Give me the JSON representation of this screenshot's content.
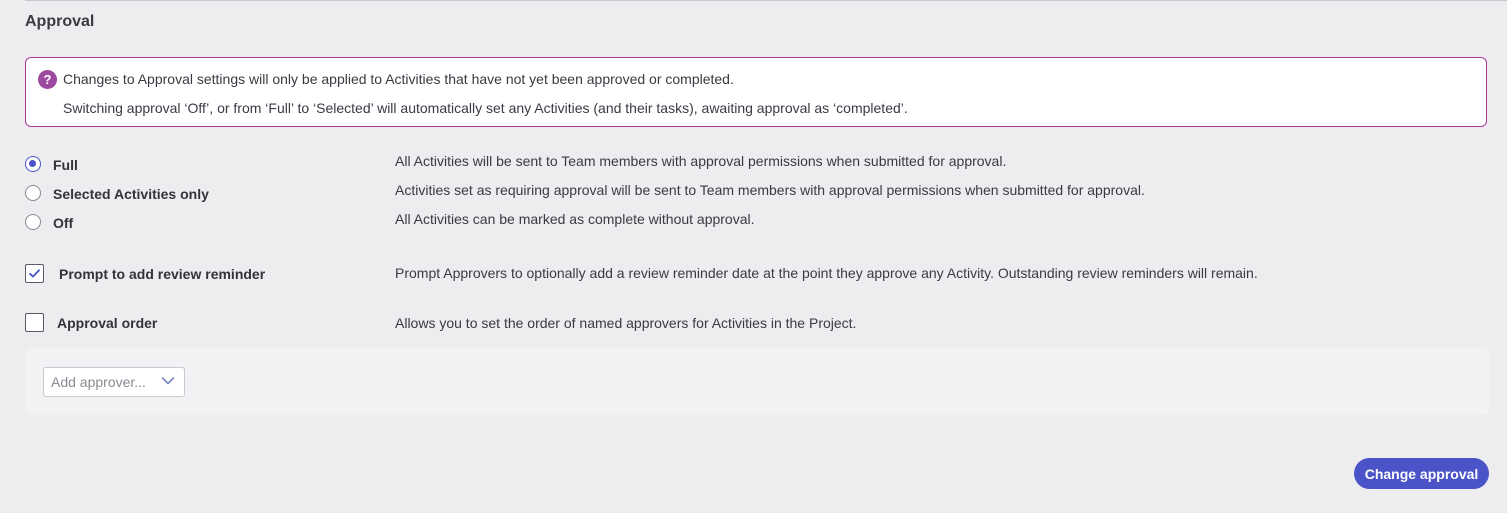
{
  "section": {
    "title": "Approval"
  },
  "notice": {
    "icon": "help-question-icon",
    "icon_glyph": "?",
    "line1": "Changes to Approval settings will only be applied to Activities that have not yet been approved or completed.",
    "line2": "Switching approval ‘Off’, or from ‘Full’ to ‘Selected’ will automatically set any Activities (and their tasks), awaiting approval as ‘completed’."
  },
  "approval_mode": {
    "selected": "Full",
    "options": [
      {
        "label": "Full",
        "description": "All Activities will be sent to Team members with approval permissions when submitted for approval.",
        "checked": true
      },
      {
        "label": "Selected Activities only",
        "description": "Activities set as requiring approval will be sent to Team members with approval permissions when submitted for approval.",
        "checked": false
      },
      {
        "label": "Off",
        "description": "All Activities can be marked as complete without approval.",
        "checked": false
      }
    ]
  },
  "settings": {
    "review_reminder": {
      "label": "Prompt to add review reminder",
      "description": "Prompt Approvers to optionally add a review reminder date at the point they approve any Activity. Outstanding review reminders will remain.",
      "checked": true
    },
    "approval_order": {
      "label": "Approval order",
      "description": "Allows you to set the order of named approvers for Activities in the Project.",
      "checked": false
    }
  },
  "approvers": {
    "select_placeholder": "Add approver..."
  },
  "actions": {
    "submit_label": "Change approval"
  },
  "colors": {
    "accent": "#4b53c8",
    "notice_border": "#a83b9e",
    "notice_icon": "#9b4aa0",
    "background": "#edecef"
  }
}
